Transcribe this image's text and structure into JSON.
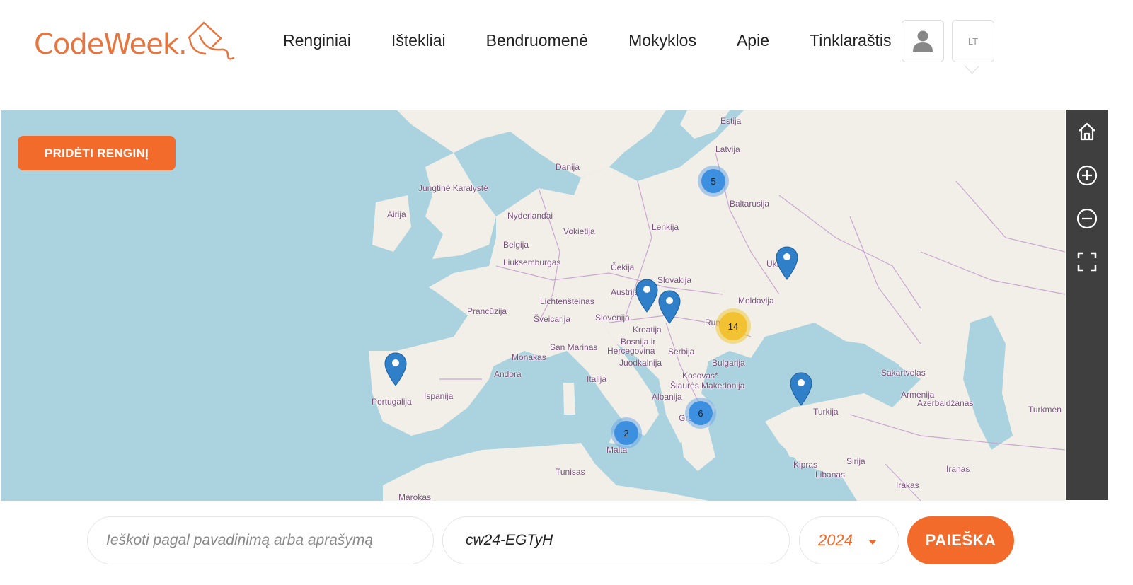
{
  "header": {
    "logo_text": "CodeWeek.",
    "nav": [
      "Renginiai",
      "Ištekliai",
      "Bendruomenė",
      "Mokyklos",
      "Apie",
      "Tinklaraštis"
    ],
    "language": "LT"
  },
  "map": {
    "add_event_label": "PRIDĖTI RENGINĮ",
    "labels": [
      "Estija",
      "Latvija",
      "Danija",
      "Jungtinė Karalystė",
      "Airija",
      "Nyderlandai",
      "Baltarusija",
      "Vokietija",
      "Lenkija",
      "Belgija",
      "Liuksemburgas",
      "Čekija",
      "Slovakija",
      "Ukraina",
      "Austrija",
      "Moldavija",
      "Lichtenšteinas",
      "Prancūzija",
      "Šveicarija",
      "Slovėnija",
      "Kroatija",
      "Rumunija",
      "Bosnija ir",
      "Hercegovina",
      "San Marinas",
      "Serbija",
      "Monakas",
      "Juodkalnija",
      "Bulgarija",
      "Andora",
      "Kosovas*",
      "Šiaurės Makedonija",
      "Sakartvelas",
      "Italija",
      "Ispanija",
      "Albanija",
      "Armėnija",
      "Azerbaidžanas",
      "Portugalija",
      "Turkija",
      "Turkmėn",
      "Graikija",
      "Malta",
      "Kipras",
      "Sirija",
      "Libanas",
      "Iranas",
      "Tunisas",
      "Irakas",
      "Marokas"
    ],
    "clusters": [
      "5",
      "14",
      "6",
      "2"
    ],
    "cluster_colors": {
      "small": "#3d8fe0",
      "medium": "#f2c232"
    },
    "controls": [
      "home-icon",
      "zoom-in-icon",
      "zoom-out-icon",
      "fullscreen-icon"
    ]
  },
  "search": {
    "query_placeholder": "Ieškoti pagal pavadinimą arba aprašymą",
    "code_value": "cw24-EGTyH",
    "year": "2024",
    "button_label": "PAIEŠKA"
  },
  "colors": {
    "accent": "#f26b2a",
    "water": "#aad3df",
    "land": "#f2efe9",
    "border": "#c9a8d0"
  }
}
